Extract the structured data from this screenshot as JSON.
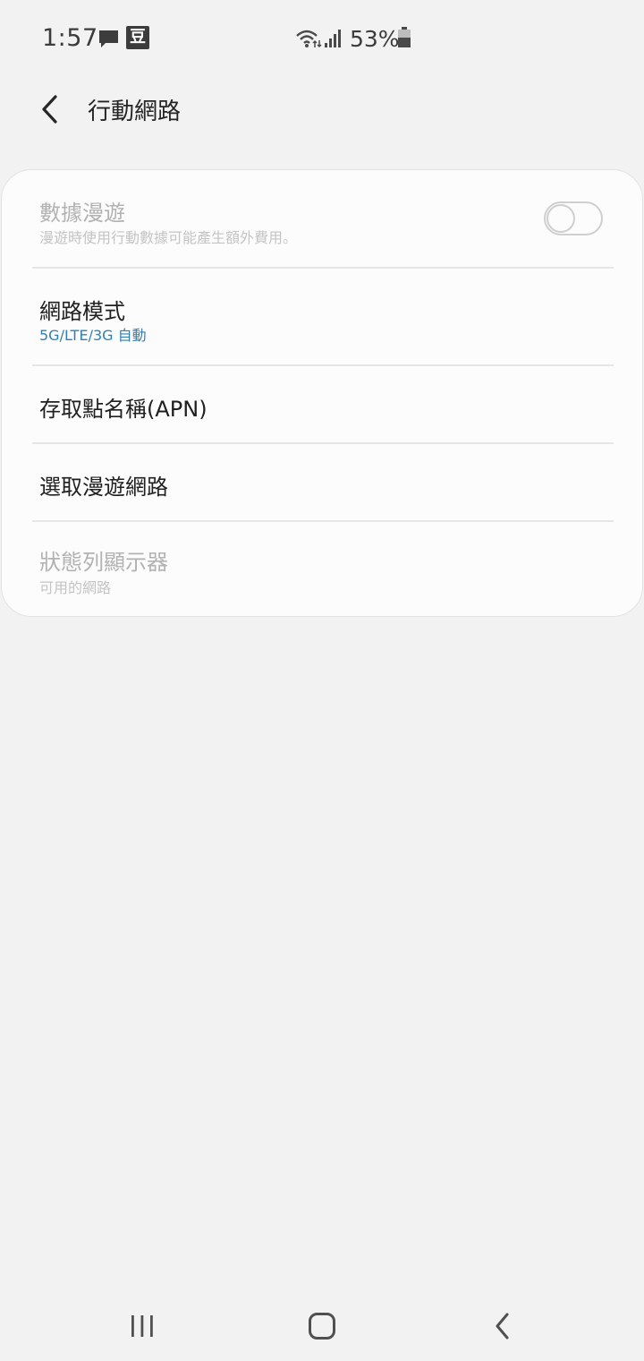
{
  "status_bar": {
    "time": "1:57",
    "battery_percent": "53%",
    "notification_icons": [
      "message-icon",
      "dou-app-icon"
    ],
    "dou_glyph": "豆",
    "system_icons": [
      "wifi-icon",
      "signal-icon",
      "battery-icon"
    ],
    "battery_level": 0.53
  },
  "app_bar": {
    "title": "行動網路",
    "back_icon": "chevron-left-icon"
  },
  "settings": {
    "data_roaming": {
      "title": "數據漫遊",
      "subtitle": "漫遊時使用行動數據可能產生額外費用。",
      "enabled": false,
      "toggle_on": false
    },
    "network_mode": {
      "title": "網路模式",
      "value": "5G/LTE/3G 自動"
    },
    "apn": {
      "title": "存取點名稱(APN)"
    },
    "roaming_network": {
      "title": "選取漫遊網路"
    },
    "status_bar_indicator": {
      "title": "狀態列顯示器",
      "subtitle": "可用的網路",
      "enabled": false
    }
  },
  "colors": {
    "background": "#f2f2f2",
    "card": "#fcfcfc",
    "accent": "#2f7fb5",
    "disabled_text": "#b2b2b2"
  },
  "nav_bar": {
    "icons": [
      "recents-icon",
      "home-icon",
      "back-icon"
    ]
  }
}
